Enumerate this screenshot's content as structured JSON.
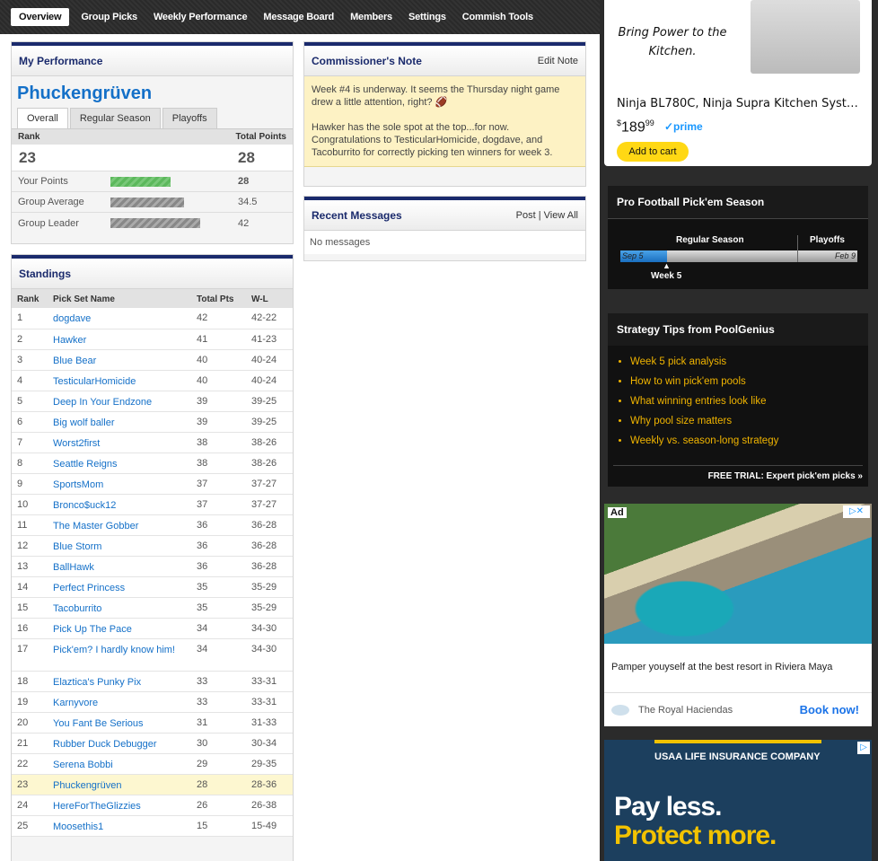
{
  "nav": {
    "items": [
      "Overview",
      "Group Picks",
      "Weekly Performance",
      "Message Board",
      "Members",
      "Settings",
      "Commish Tools"
    ]
  },
  "performance": {
    "title": "My Performance",
    "user_name": "Phuckengrüven",
    "tabs": [
      "Overall",
      "Regular Season",
      "Playoffs"
    ],
    "rank_label": "Rank",
    "total_points_label": "Total Points",
    "rank": "23",
    "total_points": "28",
    "rows": [
      {
        "label": "Your Points",
        "value": "28",
        "bar_fraction": 0.28
      },
      {
        "label": "Group Average",
        "value": "34.5",
        "bar_fraction": 0.345
      },
      {
        "label": "Group Leader",
        "value": "42",
        "bar_fraction": 0.42
      }
    ]
  },
  "standings": {
    "title": "Standings",
    "columns": [
      "Rank",
      "Pick Set Name",
      "Total Pts",
      "W-L"
    ],
    "rows": [
      {
        "rank": "1",
        "name": "dogdave",
        "pts": "42",
        "wl": "42-22"
      },
      {
        "rank": "2",
        "name": "Hawker",
        "pts": "41",
        "wl": "41-23"
      },
      {
        "rank": "3",
        "name": "Blue Bear",
        "pts": "40",
        "wl": "40-24"
      },
      {
        "rank": "4",
        "name": "TesticularHomicide",
        "pts": "40",
        "wl": "40-24"
      },
      {
        "rank": "5",
        "name": "Deep In Your Endzone",
        "pts": "39",
        "wl": "39-25"
      },
      {
        "rank": "6",
        "name": "Big wolf baller",
        "pts": "39",
        "wl": "39-25"
      },
      {
        "rank": "7",
        "name": "Worst2first",
        "pts": "38",
        "wl": "38-26"
      },
      {
        "rank": "8",
        "name": "Seattle Reigns",
        "pts": "38",
        "wl": "38-26"
      },
      {
        "rank": "9",
        "name": "SportsMom",
        "pts": "37",
        "wl": "37-27"
      },
      {
        "rank": "10",
        "name": "Bronco$uck12",
        "pts": "37",
        "wl": "37-27"
      },
      {
        "rank": "11",
        "name": "The Master Gobber",
        "pts": "36",
        "wl": "36-28"
      },
      {
        "rank": "12",
        "name": "Blue Storm",
        "pts": "36",
        "wl": "36-28"
      },
      {
        "rank": "13",
        "name": "BallHawk",
        "pts": "36",
        "wl": "36-28"
      },
      {
        "rank": "14",
        "name": "Perfect Princess",
        "pts": "35",
        "wl": "35-29"
      },
      {
        "rank": "15",
        "name": "Tacoburrito",
        "pts": "35",
        "wl": "35-29"
      },
      {
        "rank": "16",
        "name": "Pick Up The Pace",
        "pts": "34",
        "wl": "34-30"
      },
      {
        "rank": "17",
        "name": "Pick'em? I hardly know him!",
        "pts": "34",
        "wl": "34-30"
      },
      {
        "rank": "18",
        "name": "Elaztica's Punky Pix",
        "pts": "33",
        "wl": "33-31"
      },
      {
        "rank": "19",
        "name": "Karnyvore",
        "pts": "33",
        "wl": "33-31"
      },
      {
        "rank": "20",
        "name": "You Fant Be Serious",
        "pts": "31",
        "wl": "31-33"
      },
      {
        "rank": "21",
        "name": "Rubber Duck Debugger",
        "pts": "30",
        "wl": "30-34"
      },
      {
        "rank": "22",
        "name": "Serena Bobbi",
        "pts": "29",
        "wl": "29-35"
      },
      {
        "rank": "23",
        "name": "Phuckengrüven",
        "pts": "28",
        "wl": "28-36",
        "me": true
      },
      {
        "rank": "24",
        "name": "HereForTheGlizzies",
        "pts": "26",
        "wl": "26-38"
      },
      {
        "rank": "25",
        "name": "Moosethis1",
        "pts": "15",
        "wl": "15-49"
      }
    ]
  },
  "commissioner": {
    "title": "Commissioner's Note",
    "edit_label": "Edit Note",
    "para1": "Week #4 is underway. It seems the Thursday night game drew a little attention, right? 🏈",
    "para2": "Hawker has the sole spot at the top...for now. Congratulations to TesticularHomicide, dogdave, and Tacoburrito for correctly picking ten winners for week 3."
  },
  "messages": {
    "title": "Recent Messages",
    "post_label": "Post",
    "view_all_label": "View All",
    "empty_text": "No messages"
  },
  "ad_product": {
    "tagline": "Bring Power to the Kitchen.",
    "title": "Ninja BL780C, Ninja Supra Kitchen Syst…",
    "price_dollars": "189",
    "price_cents": "99",
    "prime": "✓prime",
    "cart_label": "Add to cart"
  },
  "season": {
    "title": "Pro Football Pick'em Season",
    "regular_label": "Regular Season",
    "playoffs_label": "Playoffs",
    "start_date": "Sep 5",
    "end_date": "Feb 9",
    "current_week": "Week 5"
  },
  "tips": {
    "title": "Strategy Tips from PoolGenius",
    "items": [
      "Week 5 pick analysis",
      "How to win pick'em pools",
      "What winning entries look like",
      "Why pool size matters",
      "Weekly vs. season-long strategy"
    ],
    "trial": "FREE TRIAL: Expert pick'em picks »"
  },
  "ad_resort": {
    "badge": "Ad",
    "text": "Pamper youyself at the best resort in Riviera Maya",
    "brand": "The Royal Haciendas",
    "cta": "Book now!"
  },
  "ad_usaa": {
    "company": "USAA LIFE INSURANCE COMPANY",
    "line1": "Pay less.",
    "line2": "Protect more."
  }
}
